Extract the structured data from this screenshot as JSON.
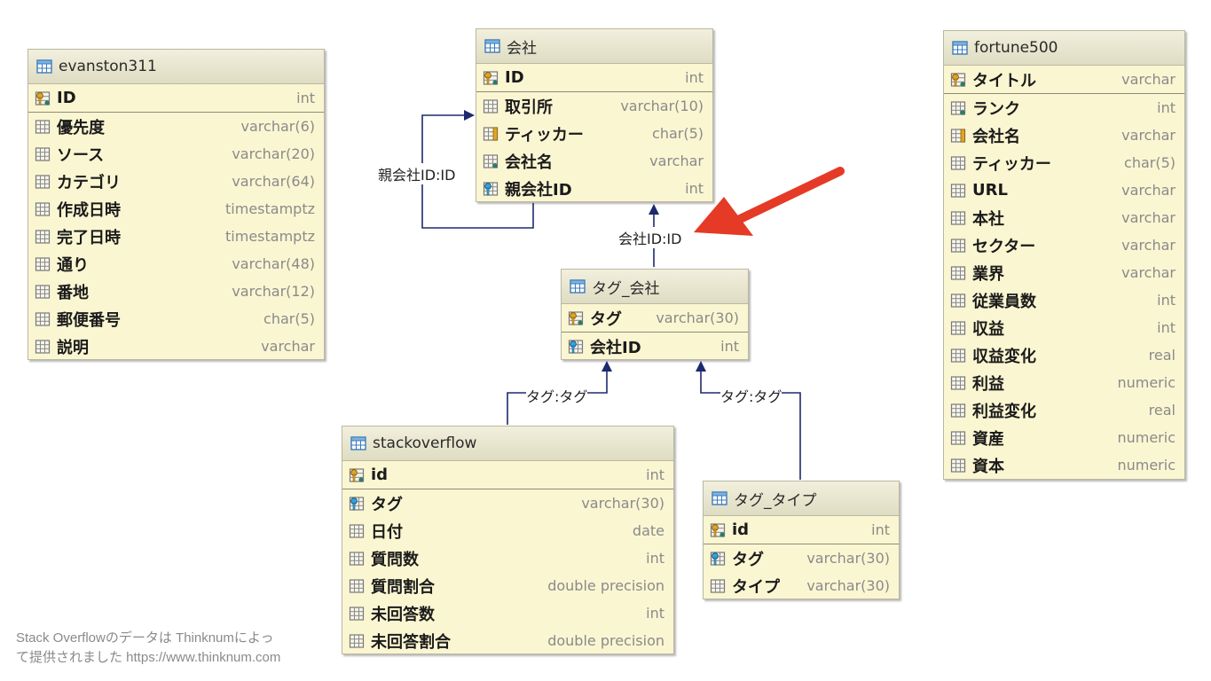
{
  "tables": {
    "evanston": {
      "title": "evanston311",
      "columns": [
        {
          "name": "ID",
          "type": "int",
          "icon": "primary-key-icon"
        },
        {
          "name": "優先度",
          "type": "varchar(6)",
          "icon": "column-icon"
        },
        {
          "name": "ソース",
          "type": "varchar(20)",
          "icon": "column-icon"
        },
        {
          "name": "カテゴリ",
          "type": "varchar(64)",
          "icon": "column-icon"
        },
        {
          "name": "作成日時",
          "type": "timestamptz",
          "icon": "column-icon"
        },
        {
          "name": "完了日時",
          "type": "timestamptz",
          "icon": "column-icon"
        },
        {
          "name": "通り",
          "type": "varchar(48)",
          "icon": "column-icon"
        },
        {
          "name": "番地",
          "type": "varchar(12)",
          "icon": "column-icon"
        },
        {
          "name": "郵便番号",
          "type": "char(5)",
          "icon": "column-icon"
        },
        {
          "name": "説明",
          "type": "varchar",
          "icon": "column-icon"
        }
      ]
    },
    "company": {
      "title": "会社",
      "columns": [
        {
          "name": "ID",
          "type": "int",
          "icon": "primary-key-icon"
        },
        {
          "name": "取引所",
          "type": "varchar(10)",
          "icon": "column-icon"
        },
        {
          "name": "ティッカー",
          "type": "char(5)",
          "icon": "unique-column-icon"
        },
        {
          "name": "会社名",
          "type": "varchar",
          "icon": "not-null-column-icon"
        },
        {
          "name": "親会社ID",
          "type": "int",
          "icon": "foreign-key-icon"
        }
      ]
    },
    "fortune": {
      "title": "fortune500",
      "columns": [
        {
          "name": "タイトル",
          "type": "varchar",
          "icon": "primary-key-icon"
        },
        {
          "name": "ランク",
          "type": "int",
          "icon": "not-null-column-icon"
        },
        {
          "name": "会社名",
          "type": "varchar",
          "icon": "unique-column-icon"
        },
        {
          "name": "ティッカー",
          "type": "char(5)",
          "icon": "column-icon"
        },
        {
          "name": "URL",
          "type": "varchar",
          "icon": "column-icon"
        },
        {
          "name": "本社",
          "type": "varchar",
          "icon": "column-icon"
        },
        {
          "name": "セクター",
          "type": "varchar",
          "icon": "column-icon"
        },
        {
          "name": "業界",
          "type": "varchar",
          "icon": "column-icon"
        },
        {
          "name": "従業員数",
          "type": "int",
          "icon": "column-icon"
        },
        {
          "name": "収益",
          "type": "int",
          "icon": "column-icon"
        },
        {
          "name": "収益変化",
          "type": "real",
          "icon": "column-icon"
        },
        {
          "name": "利益",
          "type": "numeric",
          "icon": "column-icon"
        },
        {
          "name": "利益変化",
          "type": "real",
          "icon": "column-icon"
        },
        {
          "name": "資産",
          "type": "numeric",
          "icon": "column-icon"
        },
        {
          "name": "資本",
          "type": "numeric",
          "icon": "column-icon"
        }
      ]
    },
    "tagcompany": {
      "title": "タグ_会社",
      "columns": [
        {
          "name": "タグ",
          "type": "varchar(30)",
          "icon": "primary-key-icon"
        },
        {
          "name": "会社ID",
          "type": "int",
          "icon": "foreign-key-icon"
        }
      ]
    },
    "stackoverflow": {
      "title": "stackoverflow",
      "columns": [
        {
          "name": "id",
          "type": "int",
          "icon": "primary-key-icon"
        },
        {
          "name": "タグ",
          "type": "varchar(30)",
          "icon": "foreign-key-icon"
        },
        {
          "name": "日付",
          "type": "date",
          "icon": "column-icon"
        },
        {
          "name": "質問数",
          "type": "int",
          "icon": "column-icon"
        },
        {
          "name": "質問割合",
          "type": "double precision",
          "icon": "column-icon"
        },
        {
          "name": "未回答数",
          "type": "int",
          "icon": "column-icon"
        },
        {
          "name": "未回答割合",
          "type": "double precision",
          "icon": "column-icon"
        }
      ]
    },
    "tagtype": {
      "title": "タグ_タイプ",
      "columns": [
        {
          "name": "id",
          "type": "int",
          "icon": "primary-key-icon"
        },
        {
          "name": "タグ",
          "type": "varchar(30)",
          "icon": "foreign-key-icon"
        },
        {
          "name": "タイプ",
          "type": "varchar(30)",
          "icon": "column-icon"
        }
      ]
    }
  },
  "relations": {
    "parent_company": "親会社ID:ID",
    "company_id": "会社ID:ID",
    "tag_so": "タグ:タグ",
    "tag_type": "タグ:タグ"
  },
  "footer": {
    "line1": "Stack Overflowのデータは Thinknumによっ",
    "line2": "て提供されました https://www.thinknum.com"
  },
  "colors": {
    "table_bg": "#fbf6d2",
    "connector": "#1d2a6e",
    "arrow": "#e53a26"
  }
}
